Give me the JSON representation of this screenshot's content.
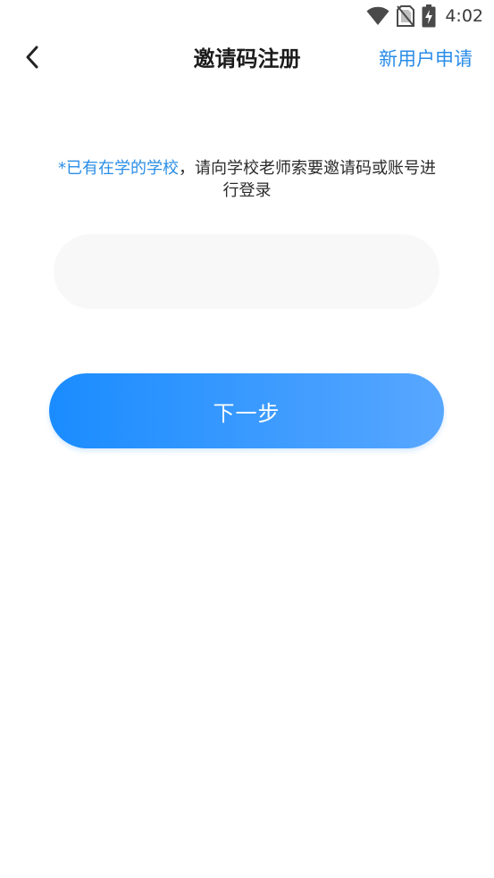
{
  "status_bar": {
    "time": "4:02",
    "icons": [
      "wifi-icon",
      "no-sim-icon",
      "battery-charging-icon"
    ]
  },
  "nav": {
    "back_icon": "chevron-left-icon",
    "title": "邀请码注册",
    "action_label": "新用户申请"
  },
  "notice": {
    "highlight": "*已有在学的学校",
    "rest": "，请向学校老师索要邀请码或账号进行登录"
  },
  "invite_input": {
    "value": "",
    "placeholder": ""
  },
  "next_button": {
    "label": "下一步"
  },
  "colors": {
    "accent": "#2a8ce8",
    "button_gradient_start": "#1a8cff",
    "button_gradient_end": "#58a7ff",
    "input_bg": "#f8f8f8"
  }
}
